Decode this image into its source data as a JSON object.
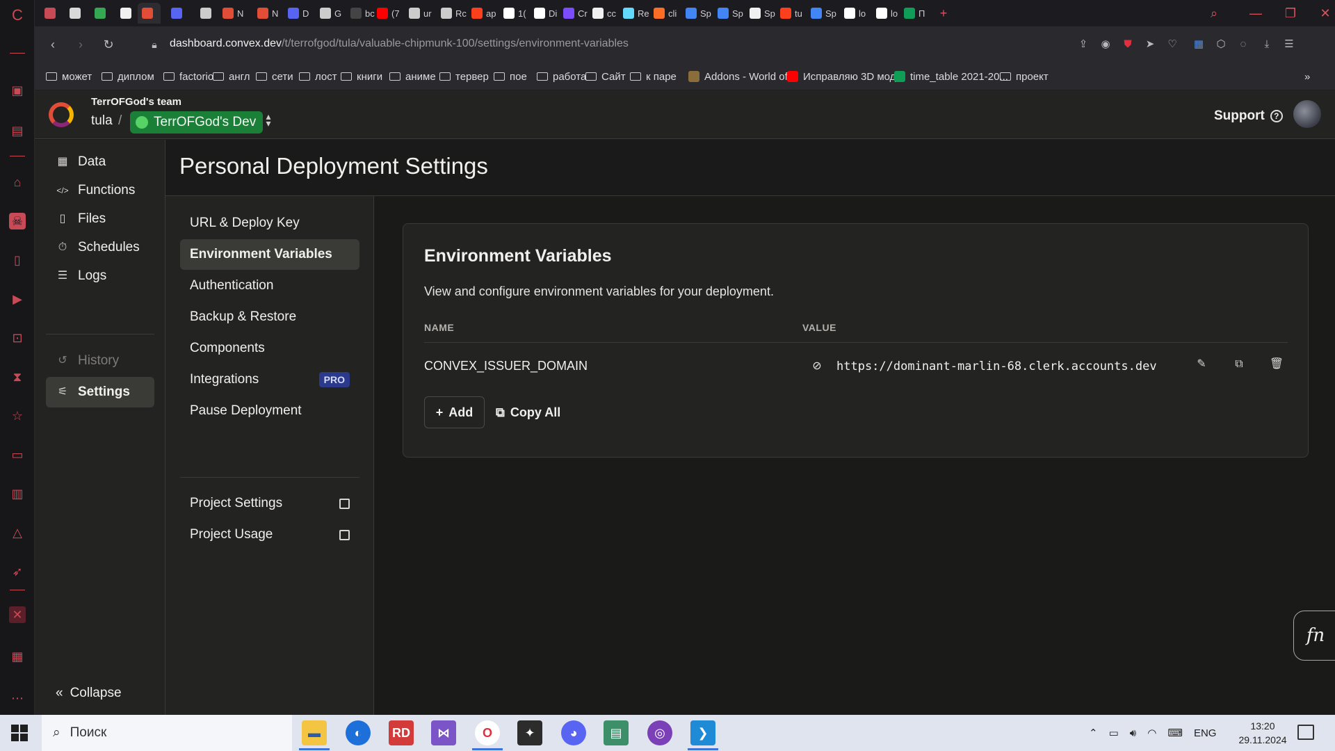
{
  "browser": {
    "tabs": [
      {
        "label": "",
        "color": "#c84a56"
      },
      {
        "label": "",
        "color": "#d9d9d9"
      },
      {
        "label": "",
        "color": "#34a853"
      },
      {
        "label": "",
        "color": "#f0f0f0"
      },
      {
        "label": "",
        "color": "#e24d38"
      },
      {
        "label": "",
        "color": "#5865f2"
      },
      {
        "label": "",
        "color": "#cccccc"
      },
      {
        "label": "N",
        "color": "#e24d38"
      },
      {
        "label": "N",
        "color": "#e24d38"
      },
      {
        "label": "D",
        "color": "#5865f2"
      },
      {
        "label": "G",
        "color": "#cccccc"
      },
      {
        "label": "bc",
        "color": "#444444"
      },
      {
        "label": "(7",
        "color": "#ff0000"
      },
      {
        "label": "ur",
        "color": "#cccccc"
      },
      {
        "label": "Rc",
        "color": "#cccccc"
      },
      {
        "label": "ap",
        "color": "#fc3f1d"
      },
      {
        "label": "1(",
        "color": "#ffffff"
      },
      {
        "label": "Di",
        "color": "#ffffff"
      },
      {
        "label": "Cr",
        "color": "#7c4dff"
      },
      {
        "label": "cc",
        "color": "#f0f0f0"
      },
      {
        "label": "Re",
        "color": "#61dafb"
      },
      {
        "label": "cli",
        "color": "#fc6d26"
      },
      {
        "label": "Sp",
        "color": "#4285f4"
      },
      {
        "label": "Sp",
        "color": "#4285f4"
      },
      {
        "label": "Sp",
        "color": "#f0f0f0"
      },
      {
        "label": "tu",
        "color": "#fc3f1d"
      },
      {
        "label": "Sp",
        "color": "#4285f4"
      },
      {
        "label": "lo",
        "color": "#ffffff"
      },
      {
        "label": "lo",
        "color": "#ffffff"
      },
      {
        "label": "П",
        "color": "#0f9d58"
      }
    ],
    "new_tab": "+",
    "url_host": "dashboard.convex.dev",
    "url_path": "/t/terrofgod/tula/valuable-chipmunk-100/settings/environment-variables",
    "bookmarks": [
      {
        "label": "может",
        "icon": "folder-icon"
      },
      {
        "label": "диплом",
        "icon": "folder-icon"
      },
      {
        "label": "factorio",
        "icon": "folder-icon"
      },
      {
        "label": "англ",
        "icon": "folder-icon"
      },
      {
        "label": "сети",
        "icon": "folder-icon"
      },
      {
        "label": "лост",
        "icon": "folder-icon"
      },
      {
        "label": "книги",
        "icon": "folder-icon"
      },
      {
        "label": "аниме",
        "icon": "folder-icon"
      },
      {
        "label": "тервер",
        "icon": "folder-icon"
      },
      {
        "label": "пое",
        "icon": "folder-icon"
      },
      {
        "label": "работа",
        "icon": "folder-icon"
      },
      {
        "label": "Сайт",
        "icon": "folder-icon"
      },
      {
        "label": "к паре",
        "icon": "folder-icon"
      },
      {
        "label": "Addons - World of...",
        "icon": "site-icon"
      },
      {
        "label": "Исправляю 3D мод...",
        "icon": "youtube-icon"
      },
      {
        "label": "time_table 2021-20...",
        "icon": "sheets-icon"
      },
      {
        "label": "проект",
        "icon": "folder-icon"
      }
    ],
    "bookmarks_more": "»"
  },
  "header": {
    "team": "TerrOFGod's team",
    "project": "tula",
    "separator": "/",
    "deployment": "TerrOFGod's Dev",
    "support": "Support",
    "support_icon": "?"
  },
  "main_nav": {
    "items": [
      {
        "label": "Data",
        "icon": "table-icon"
      },
      {
        "label": "Functions",
        "icon": "code-icon"
      },
      {
        "label": "Files",
        "icon": "file-icon"
      },
      {
        "label": "Schedules",
        "icon": "stopwatch-icon"
      },
      {
        "label": "Logs",
        "icon": "list-icon"
      }
    ],
    "history": "History",
    "settings": "Settings",
    "collapse": "Collapse"
  },
  "page": {
    "title": "Personal Deployment Settings"
  },
  "settings_nav": {
    "items": [
      {
        "label": "URL & Deploy Key"
      },
      {
        "label": "Environment Variables"
      },
      {
        "label": "Authentication"
      },
      {
        "label": "Backup & Restore"
      },
      {
        "label": "Components"
      },
      {
        "label": "Integrations",
        "badge": "PRO"
      },
      {
        "label": "Pause Deployment"
      }
    ],
    "external": [
      {
        "label": "Project Settings"
      },
      {
        "label": "Project Usage"
      }
    ]
  },
  "env_card": {
    "title": "Environment Variables",
    "description": "View and configure environment variables for your deployment.",
    "col_name": "NAME",
    "col_value": "VALUE",
    "rows": [
      {
        "name": "CONVEX_ISSUER_DOMAIN",
        "value": "https://dominant-marlin-68.clerk.accounts.dev"
      }
    ],
    "add_label": "Add",
    "copy_all_label": "Copy All"
  },
  "fn_button": "fn",
  "taskbar": {
    "search_placeholder": "Поиск",
    "lang": "ENG",
    "time": "13:20",
    "date": "29.11.2024"
  }
}
